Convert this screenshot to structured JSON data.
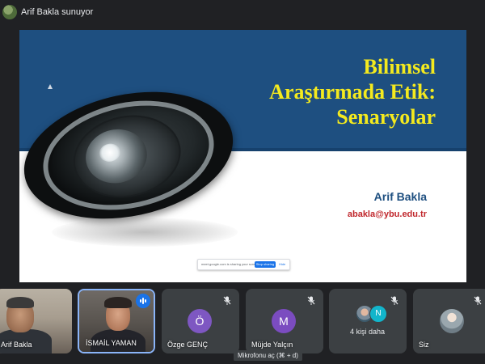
{
  "header": {
    "presenting_label": "Arif Bakla sunuyor"
  },
  "slide": {
    "title_lines": [
      "Bilimsel",
      "Araştırmada Etik:",
      "Senaryolar"
    ],
    "author": "Arif Bakla",
    "email": "abakla@ybu.edu.tr"
  },
  "share_bar": {
    "text": "meet.google.com is sharing your screen.",
    "stop_label": "Stop sharing",
    "hide_label": "Hide"
  },
  "participants": [
    {
      "name": "Arif Bakla",
      "type": "video",
      "muted": false
    },
    {
      "name": "İSMAİL YAMAN",
      "type": "video",
      "speaking": true
    },
    {
      "name": "Özge GENÇ",
      "type": "avatar",
      "initial": "Ö",
      "muted": true
    },
    {
      "name": "Müjde Yalçın",
      "type": "avatar",
      "initial": "M",
      "muted": true
    },
    {
      "name": "4 kişi daha",
      "type": "group",
      "initial": "N",
      "muted": true
    },
    {
      "name": "Siz",
      "type": "self",
      "muted": true
    }
  ],
  "tooltip": {
    "text": "Mikrofonu aç (⌘ + d)"
  },
  "colors": {
    "background": "#202124",
    "tile": "#3c4043",
    "slide_blue": "#1e4f80",
    "title_yellow": "#f4ea1e",
    "email_red": "#c0262b",
    "speaking_blue": "#1a73e8"
  },
  "icons": {
    "mute": "mic-off-icon",
    "speaking": "speaking-indicator-icon"
  }
}
